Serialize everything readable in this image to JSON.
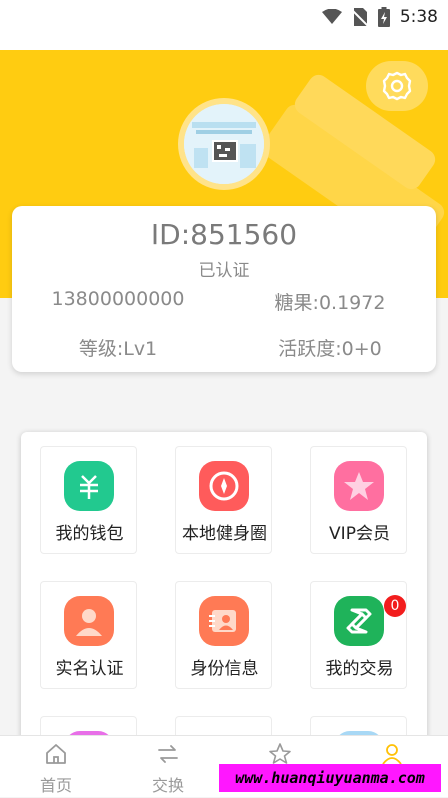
{
  "status_bar": {
    "time": "5:38"
  },
  "profile": {
    "id_text": "ID:851560",
    "verified_text": "已认证",
    "phone": "13800000000",
    "candy": "糖果:0.1972",
    "level": "等级:Lv1",
    "activity": "活跃度:0+0"
  },
  "menu": {
    "items": [
      {
        "label": "我的钱包",
        "icon": "wallet-icon",
        "color": "#22c98f"
      },
      {
        "label": "本地健身圈",
        "icon": "gym-circle-icon",
        "color": "#ff5b5b"
      },
      {
        "label": "VIP会员",
        "icon": "star-icon",
        "color": "#ff6fa0"
      },
      {
        "label": "实名认证",
        "icon": "person-icon",
        "color": "#ff7a55"
      },
      {
        "label": "身份信息",
        "icon": "id-card-icon",
        "color": "#ff7a55"
      },
      {
        "label": "我的交易",
        "icon": "exchange-icon",
        "color": "#1fb35a",
        "badge": "0"
      }
    ]
  },
  "tabbar": {
    "items": [
      {
        "label": "首页",
        "icon": "home-icon"
      },
      {
        "label": "交换",
        "icon": "swap-icon"
      },
      {
        "label": "",
        "icon": "star-outline-icon"
      },
      {
        "label": "",
        "icon": "user-icon",
        "active_color": "#ffc107"
      }
    ]
  },
  "watermark": {
    "text": "www.huanqiuyuanma.com"
  }
}
